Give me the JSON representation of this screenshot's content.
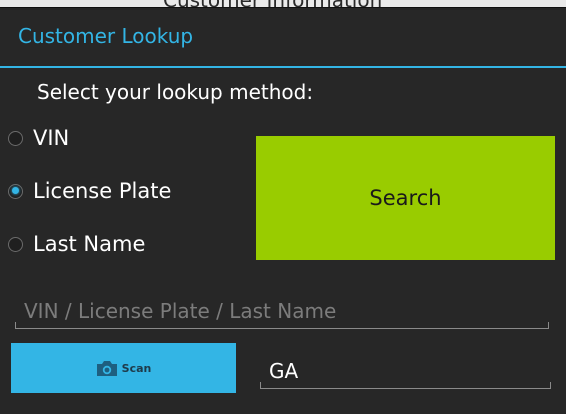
{
  "background": {
    "header_text": "Customer Information"
  },
  "dialog": {
    "title": "Customer Lookup",
    "prompt": "Select your lookup method:",
    "lookup_methods": [
      {
        "label": "VIN",
        "checked": false
      },
      {
        "label": "License Plate",
        "checked": true
      },
      {
        "label": "Last Name",
        "checked": false
      }
    ],
    "search_label": "Search",
    "query_field": {
      "value": "",
      "placeholder": "VIN / License Plate / Last Name"
    },
    "scan": {
      "label": "Scan",
      "icon": "camera-icon"
    },
    "state_field": {
      "value": "GA"
    }
  },
  "colors": {
    "accent": "#33b5e5",
    "search_button": "#99cc00",
    "dialog_bg": "#272727"
  }
}
